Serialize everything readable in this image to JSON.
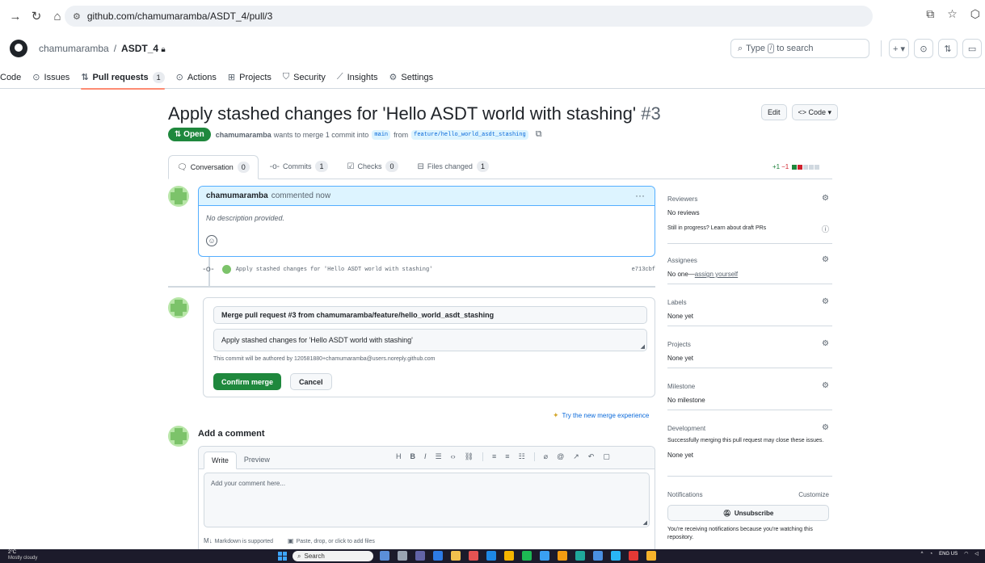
{
  "browser": {
    "url": "github.com/chamumaramba/ASDT_4/pull/3"
  },
  "header": {
    "owner": "chamumaramba",
    "separator": "/",
    "repo": "ASDT_4",
    "search_prefix": "Type",
    "search_key": "/",
    "search_suffix": "to search",
    "plus_label": "+ ▾"
  },
  "repo_nav": {
    "tabs": [
      {
        "label": "Code",
        "count": ""
      },
      {
        "label": "Issues",
        "count": ""
      },
      {
        "label": "Pull requests",
        "count": "1"
      },
      {
        "label": "Actions",
        "count": ""
      },
      {
        "label": "Projects",
        "count": ""
      },
      {
        "label": "Security",
        "count": ""
      },
      {
        "label": "Insights",
        "count": ""
      },
      {
        "label": "Settings",
        "count": ""
      }
    ]
  },
  "pr": {
    "title": "Apply stashed changes for 'Hello ASDT world with stashing'",
    "number": "#3",
    "edit_label": "Edit",
    "code_label": "<> Code ▾",
    "state": "Open",
    "author": "chamumaramba",
    "meta_text": "wants to merge 1 commit into",
    "base_branch": "main",
    "from_text": "from",
    "head_branch": "feature/hello_world_asdt_stashing"
  },
  "pr_tabs": [
    {
      "label": "Conversation",
      "count": "0"
    },
    {
      "label": "Commits",
      "count": "1"
    },
    {
      "label": "Checks",
      "count": "0"
    },
    {
      "label": "Files changed",
      "count": "1"
    }
  ],
  "diffstat": {
    "additions": "+1",
    "deletions": "−1"
  },
  "comment": {
    "author": "chamumaramba",
    "action": "commented now",
    "body": "No description provided."
  },
  "commit": {
    "message": "Apply stashed changes for 'Hello ASDT world with stashing'",
    "sha": "e713cbf"
  },
  "merge": {
    "title": "Merge pull request #3 from chamumaramba/feature/hello_world_asdt_stashing",
    "body": "Apply stashed changes for 'Hello ASDT world with stashing'",
    "note": "This commit will be authored by 120581880+chamumaramba@users.noreply.github.com",
    "confirm_label": "Confirm merge",
    "cancel_label": "Cancel",
    "try_new": "Try the new merge experience"
  },
  "add_comment": {
    "title": "Add a comment",
    "write_tab": "Write",
    "preview_tab": "Preview",
    "placeholder": "Add your comment here...",
    "markdown_note": "Markdown is supported",
    "attach_note": "Paste, drop, or click to add files"
  },
  "sidebar": {
    "reviewers": {
      "title": "Reviewers",
      "value": "No reviews",
      "hint": "Still in progress? Learn about draft PRs"
    },
    "assignees": {
      "title": "Assignees",
      "value_prefix": "No one—",
      "value_link": "assign yourself"
    },
    "labels": {
      "title": "Labels",
      "value": "None yet"
    },
    "projects": {
      "title": "Projects",
      "value": "None yet"
    },
    "milestone": {
      "title": "Milestone",
      "value": "No milestone"
    },
    "development": {
      "title": "Development",
      "note": "Successfully merging this pull request may close these issues.",
      "value": "None yet"
    },
    "notifications": {
      "title": "Notifications",
      "customize": "Customize",
      "button": "Unsubscribe",
      "note": "You're receiving notifications because you're watching this repository."
    }
  },
  "taskbar": {
    "temp": "2°C",
    "weather": "Mostly cloudy",
    "search": "Search",
    "lang": "ENG",
    "region": "US"
  },
  "colors": {
    "open_green": "#1f883d",
    "link_blue": "#0969da",
    "tab_underline": "#fd8c73",
    "comment_header": "#ddf4ff"
  }
}
